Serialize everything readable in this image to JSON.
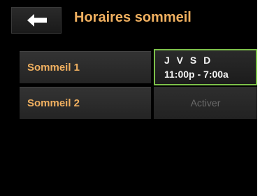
{
  "header": {
    "title": "Horaires sommeil",
    "back_icon": "left-arrow-icon"
  },
  "schedules": [
    {
      "label": "Sommeil 1",
      "days": "J V S D",
      "time": "11:00p - 7:00a",
      "selected": true
    },
    {
      "label": "Sommeil 2",
      "action": "Activer",
      "selected": false
    }
  ],
  "colors": {
    "accent_text": "#f0b060",
    "selection_border": "#7cc04a",
    "background": "#000000"
  }
}
